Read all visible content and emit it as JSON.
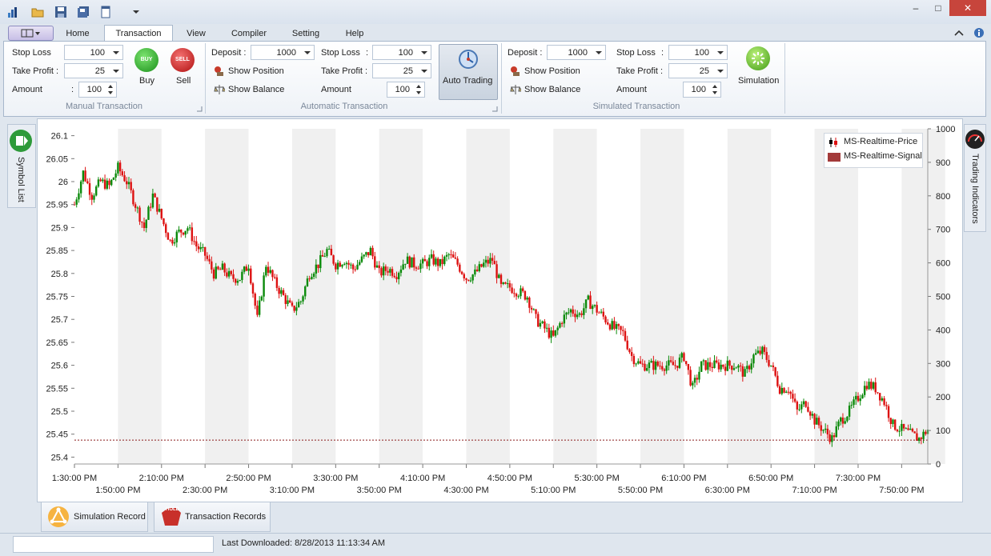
{
  "quick_access": {
    "icons": [
      "app-logo-icon",
      "open-folder-icon",
      "save-icon",
      "save-all-icon",
      "new-document-icon",
      "customize-dropdown-icon"
    ]
  },
  "window": {
    "minimize": "–",
    "maximize": "□",
    "close": "✕"
  },
  "tabs": {
    "home": "Home",
    "transaction": "Transaction",
    "view": "View",
    "compiler": "Compiler",
    "setting": "Setting",
    "help": "Help"
  },
  "manual": {
    "stop_loss_label": "Stop Loss",
    "stop_loss_value": "100",
    "take_profit_label": "Take Profit :",
    "take_profit_value": "25",
    "amount_label": "Amount",
    "amount_colon": ":",
    "amount_value": "100",
    "buy_badge": "BUY",
    "buy_label": "Buy",
    "sell_badge": "SELL",
    "sell_label": "Sell",
    "group_label": "Manual Transaction"
  },
  "automatic": {
    "deposit_label": "Deposit :",
    "deposit_value": "1000",
    "show_position": "Show Position",
    "show_balance": "Show Balance",
    "stop_loss_label": "Stop Loss",
    "stop_loss_colon": ":",
    "stop_loss_value": "100",
    "take_profit_label": "Take Profit :",
    "take_profit_value": "25",
    "amount_label": "Amount",
    "amount_value": "100",
    "auto_trading_label": "Auto Trading",
    "group_label": "Automatic Transaction"
  },
  "simulated": {
    "deposit_label": "Deposit :",
    "deposit_value": "1000",
    "show_position": "Show Position",
    "show_balance": "Show Balance",
    "stop_loss_label": "Stop Loss",
    "stop_loss_colon": ":",
    "stop_loss_value": "100",
    "take_profit_label": "Take Profit :",
    "take_profit_value": "25",
    "amount_label": "Amount",
    "amount_value": "100",
    "simulation_label": "Simulation",
    "group_label": "Simulated Transaction"
  },
  "side": {
    "symbol_list": "Symbol List",
    "trading_indicators": "Trading Indicators"
  },
  "chart_data": {
    "type": "candlestick",
    "legend": [
      "MS-Realtime-Price",
      "MS-Realtime-Signal"
    ],
    "legend_position": "top-right",
    "y_left_ticks": [
      "26.1",
      "26.05",
      "26",
      "25.95",
      "25.9",
      "25.85",
      "25.8",
      "25.75",
      "25.7",
      "25.65",
      "25.6",
      "25.55",
      "25.5",
      "25.45",
      "25.4"
    ],
    "y_left_range": [
      25.385,
      26.115
    ],
    "y_right_ticks": [
      "1000",
      "900",
      "800",
      "700",
      "600",
      "500",
      "400",
      "300",
      "200",
      "100",
      "0"
    ],
    "y_right_range": [
      0,
      1000
    ],
    "x_ticks_top": [
      "1:30:00 PM",
      "2:10:00 PM",
      "2:50:00 PM",
      "3:30:00 PM",
      "4:10:00 PM",
      "4:50:00 PM",
      "5:30:00 PM",
      "6:10:00 PM",
      "6:50:00 PM",
      "7:30:00 PM"
    ],
    "x_ticks_bottom": [
      "1:50:00 PM",
      "2:30:00 PM",
      "3:10:00 PM",
      "3:50:00 PM",
      "4:30:00 PM",
      "5:10:00 PM",
      "5:50:00 PM",
      "6:30:00 PM",
      "7:10:00 PM",
      "7:50:00 PM"
    ],
    "x_range_minutes": [
      0,
      392
    ],
    "price_series_minutes": [
      0,
      4,
      8,
      12,
      16,
      20,
      24,
      28,
      32,
      36,
      40,
      44,
      48,
      52,
      56,
      60,
      64,
      68,
      72,
      76,
      80,
      84,
      88,
      92,
      96,
      100,
      104,
      108,
      112,
      116,
      120,
      124,
      128,
      132,
      136,
      140,
      144,
      148,
      152,
      156,
      160,
      164,
      168,
      172,
      176,
      180,
      184,
      188,
      192,
      196,
      200,
      204,
      208,
      212,
      216,
      220,
      224,
      228,
      232,
      236,
      240,
      244,
      248,
      252,
      256,
      260,
      264,
      268,
      272,
      276,
      280,
      284,
      288,
      292,
      296,
      300,
      304,
      308,
      312,
      316,
      320,
      324,
      328,
      332,
      336,
      340,
      344,
      348,
      352,
      356,
      360,
      364,
      368,
      372,
      376,
      380,
      384,
      388,
      392
    ],
    "price_series_values": [
      25.95,
      26.02,
      25.97,
      26.0,
      25.99,
      26.03,
      26.0,
      25.95,
      25.9,
      25.97,
      25.92,
      25.87,
      25.89,
      25.9,
      25.86,
      25.84,
      25.8,
      25.81,
      25.79,
      25.79,
      25.82,
      25.7,
      25.82,
      25.78,
      25.75,
      25.72,
      25.74,
      25.8,
      25.82,
      25.85,
      25.82,
      25.83,
      25.81,
      25.83,
      25.85,
      25.8,
      25.81,
      25.8,
      25.83,
      25.82,
      25.82,
      25.83,
      25.82,
      25.84,
      25.82,
      25.79,
      25.8,
      25.82,
      25.83,
      25.77,
      25.77,
      25.76,
      25.75,
      25.7,
      25.68,
      25.66,
      25.7,
      25.72,
      25.71,
      25.74,
      25.72,
      25.7,
      25.68,
      25.67,
      25.62,
      25.6,
      25.6,
      25.6,
      25.6,
      25.6,
      25.62,
      25.55,
      25.6,
      25.6,
      25.6,
      25.6,
      25.6,
      25.58,
      25.62,
      25.63,
      25.6,
      25.55,
      25.55,
      25.5,
      25.52,
      25.48,
      25.46,
      25.44,
      25.48,
      25.5,
      25.53,
      25.56,
      25.55,
      25.52,
      25.47,
      25.46,
      25.45,
      25.44,
      25.46
    ],
    "signal_level": 25.437
  },
  "bottom_tabs": {
    "simulation_record": "Simulation Record",
    "transaction_records": "Transaction Records",
    "hold_badge": "HOLD"
  },
  "status": {
    "last_downloaded": "Last Downloaded: 8/28/2013 11:13:34 AM"
  },
  "colors": {
    "up_candle": "#0a8a0a",
    "down_candle": "#dd1111",
    "signal_line": "#8b1a1a",
    "band": "#f0f0f0"
  }
}
